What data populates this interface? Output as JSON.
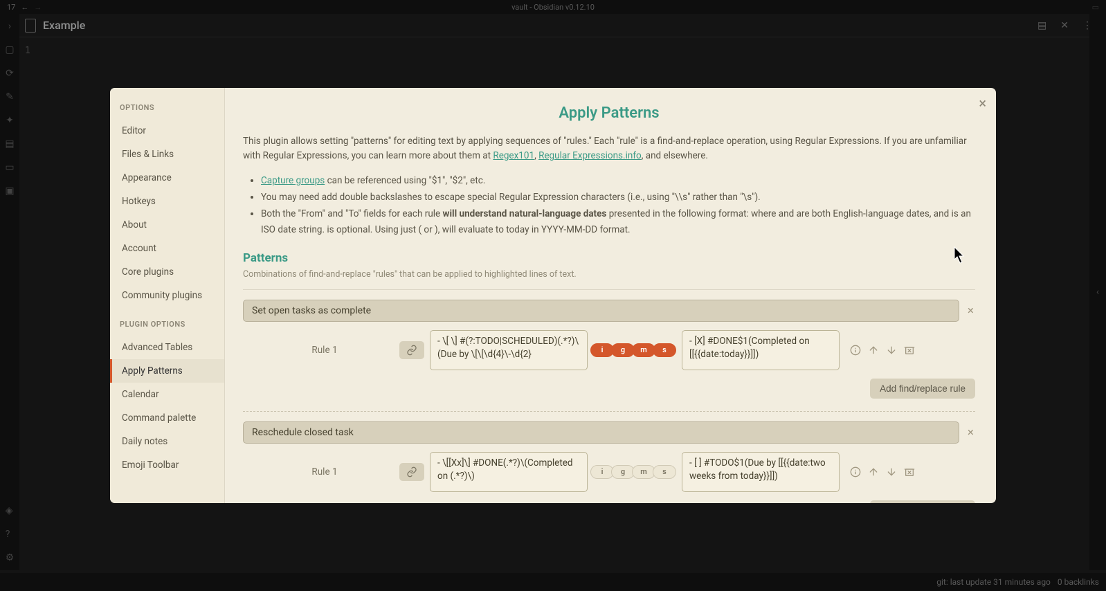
{
  "titlebar": {
    "left_num": "17",
    "center": "vault - Obsidian v0.12.10"
  },
  "tab": {
    "title": "Example"
  },
  "gutter": {
    "line1": "1"
  },
  "statusbar": {
    "git": "git: last update 31 minutes ago",
    "backlinks": "0 backlinks"
  },
  "sidebar": {
    "heading_options": "OPTIONS",
    "options": [
      "Editor",
      "Files & Links",
      "Appearance",
      "Hotkeys",
      "About",
      "Account",
      "Core plugins",
      "Community plugins"
    ],
    "heading_plugin": "PLUGIN OPTIONS",
    "plugins": [
      "Advanced Tables",
      "Apply Patterns",
      "Calendar",
      "Command palette",
      "Daily notes",
      "Emoji Toolbar"
    ],
    "active": "Apply Patterns"
  },
  "page": {
    "title": "Apply Patterns",
    "intro_1": "This plugin allows setting \"patterns\" for editing text by applying sequences of \"rules.\" Each \"rule\" is a find-and-replace operation, using Regular Expressions. If you are unfamiliar with Regular Expressions, you can learn more about them at ",
    "link_regex101": "Regex101",
    "link_regexinfo": "Regular Expressions.info",
    "intro_2": ", and elsewhere.",
    "bullet_cg_link": "Capture groups",
    "bullet_cg_rest": " can be referenced using \"$1\", \"$2\", etc.",
    "bullet_esc": "You may need add double backslashes to escape special Regular Expression characters (i.e., using \"\\\\s\" rather than \"\\s\").",
    "bullet_nl_1": "Both the \"From\" and \"To\" fields for each rule ",
    "bullet_nl_bold": "will understand natural-language dates",
    "bullet_nl_2": " presented in the following format: where and are both English-language dates, and is an ISO date string. is optional. Using just ( or ), will evaluate to today in YYYY-MM-DD format.",
    "section_title": "Patterns",
    "section_sub": "Combinations of find-and-replace \"rules\" that can be applied to highlighted lines of text.",
    "add_rule_label": "Add find/replace rule"
  },
  "flags_labels": [
    "i",
    "g",
    "m",
    "s"
  ],
  "patterns": [
    {
      "name": "Set open tasks as complete",
      "rules": [
        {
          "label": "Rule 1",
          "from": "- \\[ \\] #(?:TODO|SCHEDULED)(.*?)\\(Due by \\[\\[\\d{4}\\-\\d{2}",
          "flags_on": [
            true,
            true,
            true,
            true
          ],
          "to": "- [X] #DONE$1(Completed on [[{{date:today}}]])"
        }
      ]
    },
    {
      "name": "Reschedule closed task",
      "rules": [
        {
          "label": "Rule 1",
          "from": "- \\[[Xx]\\] #DONE(.*?)\\(Completed on (.*?)\\)",
          "flags_on": [
            false,
            false,
            false,
            false
          ],
          "to": "- [ ] #TODO$1(Due by [[{{date:two weeks from today}}]])"
        }
      ]
    }
  ]
}
